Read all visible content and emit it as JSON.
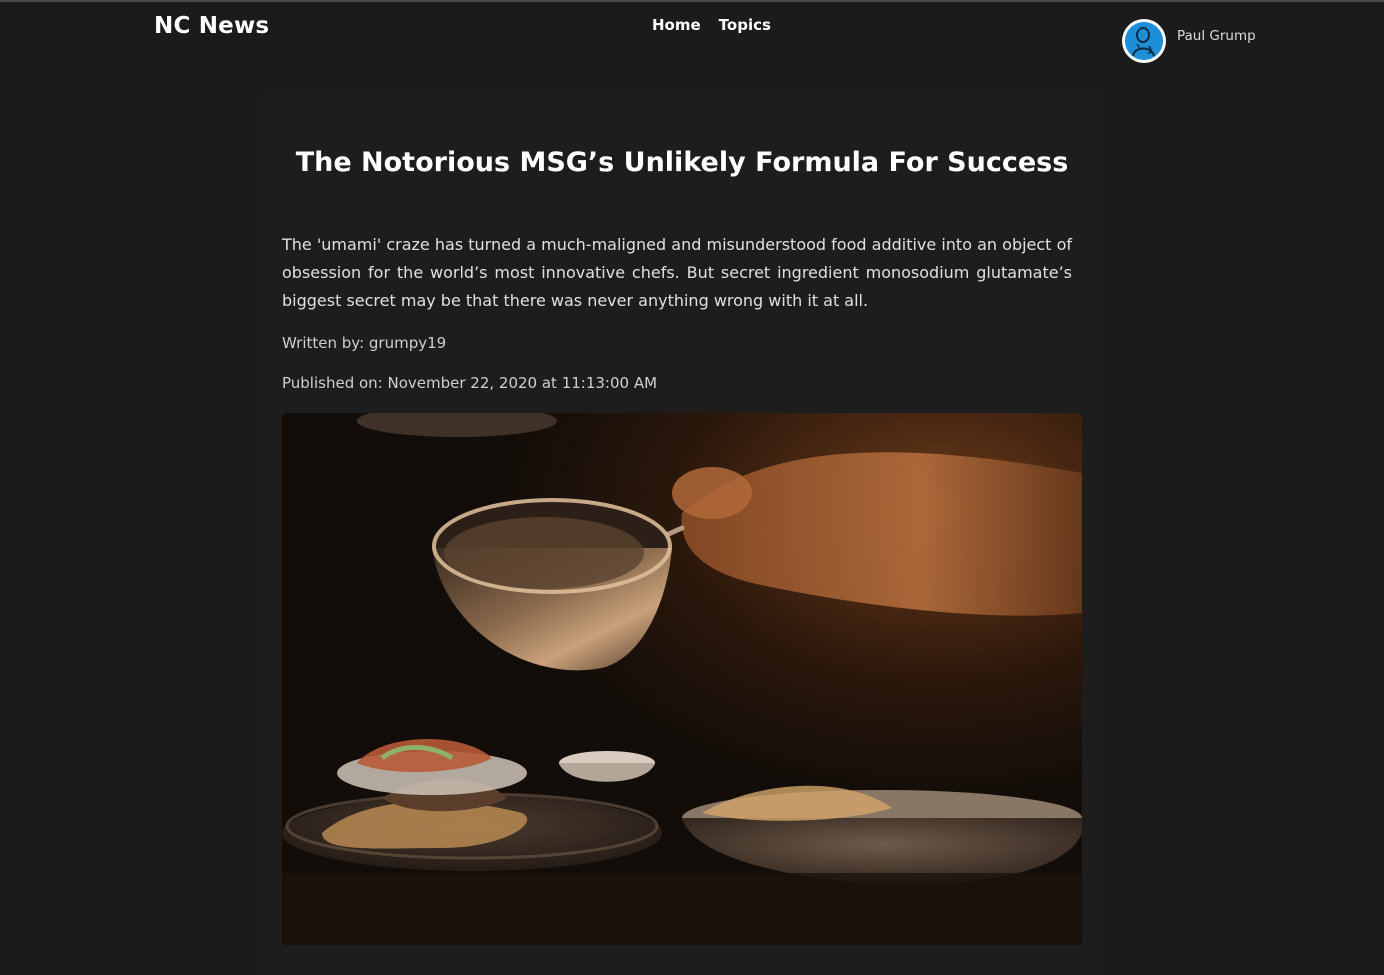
{
  "header": {
    "brand": "NC News",
    "nav": [
      {
        "label": "Home"
      },
      {
        "label": "Topics"
      }
    ],
    "user": {
      "name": "Paul Grump"
    }
  },
  "article": {
    "title": "The Notorious MSG’s Unlikely Formula For Success",
    "body": "The 'umami' craze has turned a much-maligned and misunderstood food additive into an object of obsession for the world’s most innovative chefs. But secret ingredient monosodium glutamate’s biggest secret may be that there was never anything wrong with it at all.",
    "author_line": "Written by: grumpy19",
    "published_line": "Published on: November 22, 2020 at 11:13:00 AM"
  },
  "colors": {
    "background": "#1b1b1b",
    "text": "#ffffff",
    "avatar_blue": "#1e8fd6"
  }
}
